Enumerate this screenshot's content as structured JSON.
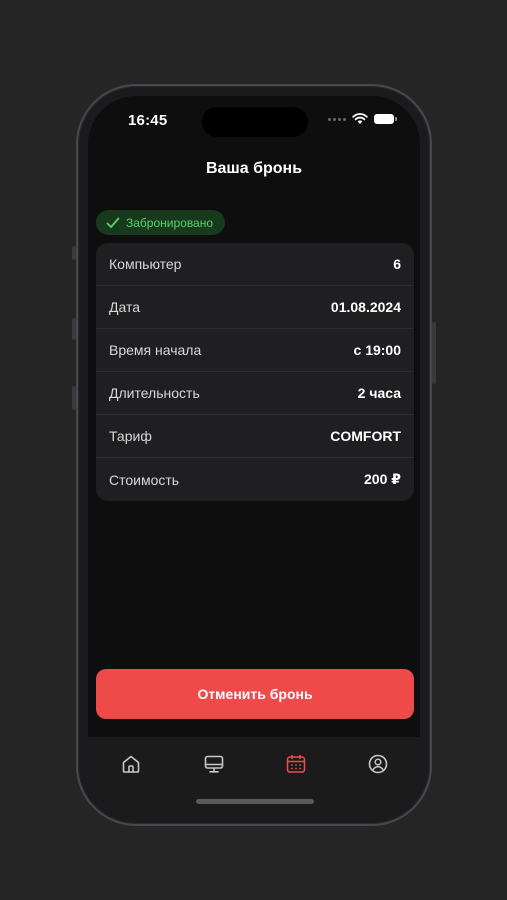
{
  "status_bar": {
    "time": "16:45"
  },
  "header": {
    "title": "Ваша бронь"
  },
  "booking_status": {
    "label": "Забронировано",
    "color": "#5fd069"
  },
  "details": [
    {
      "label": "Компьютер",
      "value": "6"
    },
    {
      "label": "Дата",
      "value": "01.08.2024"
    },
    {
      "label": "Время начала",
      "value": "с 19:00"
    },
    {
      "label": "Длительность",
      "value": "2 часа"
    },
    {
      "label": "Тариф",
      "value": "COMFORT"
    },
    {
      "label": "Стоимость",
      "value": "200 ₽"
    }
  ],
  "actions": {
    "cancel_label": "Отменить бронь"
  },
  "tab_bar": {
    "items": [
      {
        "icon": "home-icon",
        "active": false
      },
      {
        "icon": "monitor-icon",
        "active": false
      },
      {
        "icon": "calendar-icon",
        "active": true
      },
      {
        "icon": "profile-icon",
        "active": false
      }
    ]
  },
  "colors": {
    "accent": "#ef4a4a",
    "success": "#5fd069",
    "background": "#0e0e0e",
    "card": "#1f1f21"
  }
}
